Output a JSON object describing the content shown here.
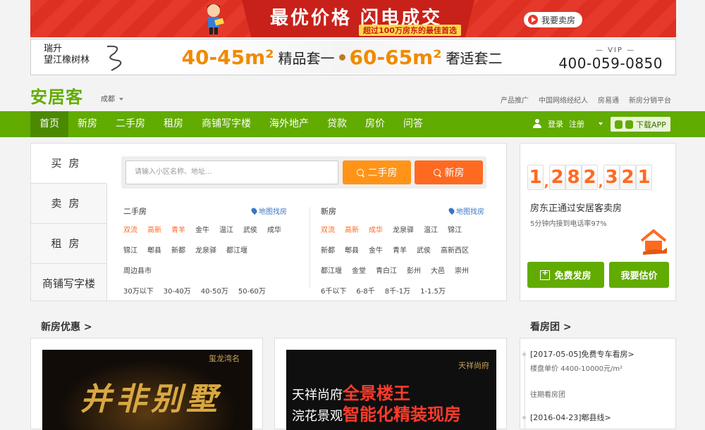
{
  "banner_top": {
    "headline": "最优价格  闪电成交",
    "subline": "超过100万房东的最佳首选",
    "cta": "我要卖房"
  },
  "banner_2": {
    "brand_line1": "瑞升",
    "brand_line2": "望江橡树林",
    "size1": "40-45m²",
    "desc1": "精品套一",
    "size2": "60-65m²",
    "desc2": "奢适套二",
    "vip": "— VIP —",
    "phone": "400-059-0850"
  },
  "header": {
    "logo": "安居客",
    "city": "成都",
    "links": [
      "产品推广",
      "中国网络经纪人",
      "房易通",
      "新房分销平台"
    ]
  },
  "nav": {
    "items": [
      "首页",
      "新房",
      "二手房",
      "租房",
      "商铺写字楼",
      "海外地产",
      "贷款",
      "房价",
      "问答"
    ],
    "login": "登录",
    "register": "注册",
    "app": "下载APP"
  },
  "side_tabs": [
    "买房",
    "卖房",
    "租房",
    "商铺写字楼"
  ],
  "search": {
    "placeholder": "请输入小区名称、地址...",
    "btn_second": "二手房",
    "btn_new": "新房"
  },
  "second_hand": {
    "title": "二手房",
    "map": "地图找房",
    "row1": [
      {
        "t": "双流",
        "hot": true
      },
      {
        "t": "高新",
        "hot": true
      },
      {
        "t": "青羊",
        "hot": true
      },
      {
        "t": "金牛"
      },
      {
        "t": "温江"
      },
      {
        "t": "武侯"
      },
      {
        "t": "成华"
      }
    ],
    "row2": [
      "锦江",
      "郫县",
      "新都",
      "龙泉驿",
      "都江堰"
    ],
    "row3": [
      "周边县市"
    ],
    "prices": [
      "30万以下",
      "30-40万",
      "40-50万",
      "50-60万"
    ]
  },
  "new_house": {
    "title": "新房",
    "map": "地图找房",
    "row1": [
      {
        "t": "双流",
        "hot": true
      },
      {
        "t": "高新",
        "hot": true
      },
      {
        "t": "成华",
        "hot": true
      },
      {
        "t": "龙泉驿"
      },
      {
        "t": "温江"
      },
      {
        "t": "锦江"
      }
    ],
    "row2": [
      "新都",
      "郫县",
      "金牛",
      "青羊",
      "武侯",
      "高新西区"
    ],
    "row3": [
      "都江堰",
      "金堂",
      "青白江",
      "彭州",
      "大邑",
      "崇州"
    ],
    "prices": [
      "6千以下",
      "6-8千",
      "8千-1万",
      "1-1.5万"
    ]
  },
  "stats": {
    "digits": [
      "1",
      ",",
      "2",
      "8",
      "2",
      ",",
      "3",
      "2",
      "1"
    ],
    "line1": "房东正通过安居客卖房",
    "line2": "5分钟内接到电话率97%",
    "btn_publish": "免费发房",
    "btn_estimate": "我要估价"
  },
  "sections": {
    "new_deals": "新房优惠  >",
    "tour": "看房团  >"
  },
  "poster1": {
    "brand": "玺龙湾名",
    "text": "并非别墅"
  },
  "poster2": {
    "brand": "天祥尚府",
    "l1a": "天祥尚府",
    "l1b": "全景楼王",
    "l2a": "浣花景观",
    "l2b": "智能化精装现房"
  },
  "tour": {
    "item1": "[2017-05-05]免费专车看房>",
    "item1_sub": "楼盘单价 4400-10000元/m²",
    "past": "往期看房团",
    "item2": "[2016-04-23]郫县线>"
  },
  "colors": {
    "brand_green": "#62ab00",
    "orange": "#ff9419",
    "orange_red": "#ff6a21"
  }
}
